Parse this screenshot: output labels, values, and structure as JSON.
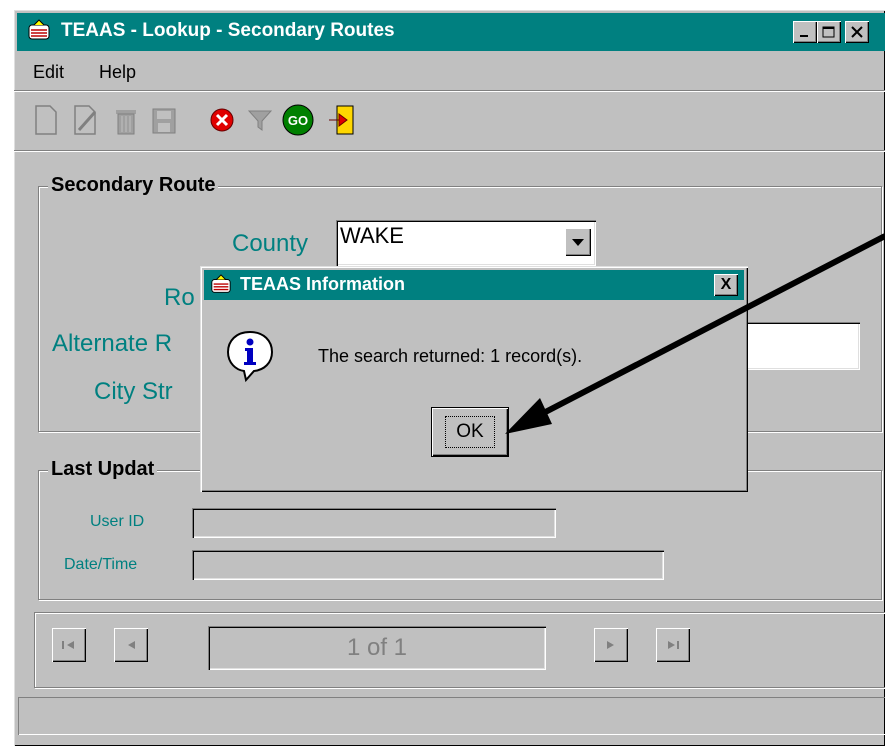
{
  "window": {
    "title": "TEAAS - Lookup - Secondary Routes"
  },
  "menubar": {
    "items": [
      {
        "label": "Edit"
      },
      {
        "label": "Help"
      }
    ]
  },
  "toolbar": {
    "tools": [
      "new-icon",
      "edit-icon",
      "delete-icon",
      "save-icon",
      "cancel-icon",
      "filter-icon",
      "go-icon",
      "exit-icon"
    ],
    "go_label": "GO"
  },
  "secondary_route": {
    "title": "Secondary Route",
    "county_label": "County",
    "county_value": "WAKE",
    "route_label_partial": "Ro",
    "alternate_label_partial": "Alternate R",
    "city_label_partial": "City Str"
  },
  "last_updated": {
    "title_partial": "Last Updat",
    "user_id_label": "User ID",
    "user_id_value": "",
    "datetime_label": "Date/Time",
    "datetime_value": ""
  },
  "navigation": {
    "record_position": "1 of 1"
  },
  "dialog": {
    "title": "TEAAS Information",
    "message": "The search returned: 1 record(s).",
    "ok_label": "OK",
    "close_label": "X"
  },
  "colors": {
    "title_bar": "#008080",
    "label_teal": "#008080",
    "face": "#c0c0c0"
  }
}
